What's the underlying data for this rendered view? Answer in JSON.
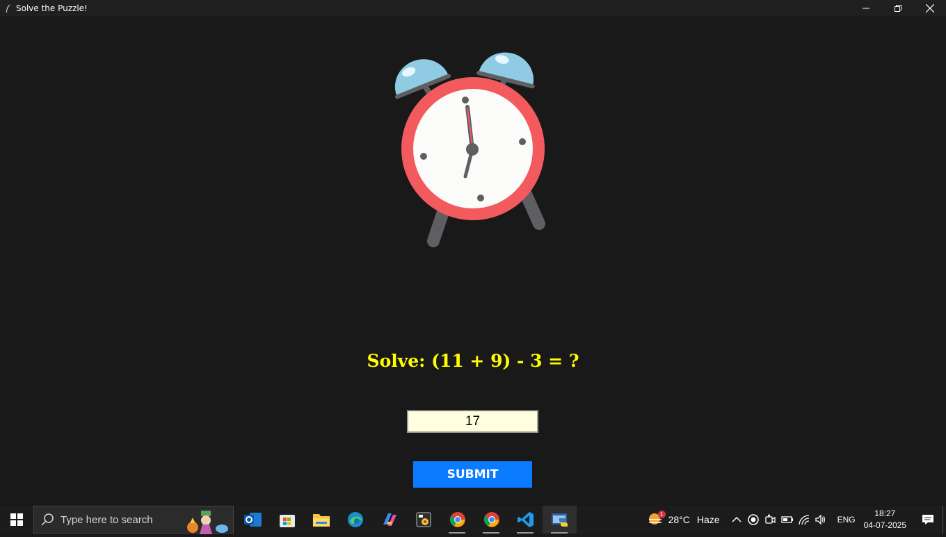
{
  "window": {
    "title": "Solve the Puzzle!",
    "icon": "feather-icon"
  },
  "puzzle": {
    "question": "Solve: (11 + 9) - 3 = ?",
    "answer_value": "17",
    "submit_label": "SUBMIT"
  },
  "colors": {
    "background": "#1a191a",
    "question": "#ffff00",
    "input_bg": "#ffffe0",
    "button": "#0b7bff",
    "clock_ring": "#f25a5e",
    "clock_bells": "#8fcbe3"
  },
  "taskbar": {
    "search_placeholder": "Type here to search",
    "apps": [
      "outlook-icon",
      "store-icon",
      "file-explorer-icon",
      "edge-icon",
      "copilot-icon",
      "media-icon",
      "chrome-icon",
      "chrome-icon",
      "vscode-icon",
      "python-app-icon"
    ],
    "weather": {
      "temp": "28°C",
      "condition": "Haze",
      "badge": "1"
    },
    "language": "ENG",
    "time": "18:27",
    "date": "04-07-2025"
  }
}
